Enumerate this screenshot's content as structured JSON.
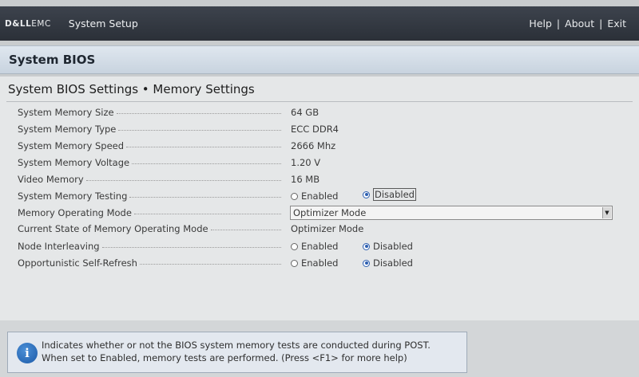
{
  "topbar": {
    "logo_bold": "D&LL",
    "logo_rest": "EMC",
    "title": "System Setup",
    "links": [
      "Help",
      "About",
      "Exit"
    ],
    "separator": "|"
  },
  "page_header": "System BIOS",
  "subtitle": "System BIOS Settings • Memory Settings",
  "settings": [
    {
      "label": "System Memory Size",
      "value": "64 GB"
    },
    {
      "label": "System Memory Type",
      "value": "ECC DDR4"
    },
    {
      "label": "System Memory Speed",
      "value": "2666 Mhz"
    },
    {
      "label": "System Memory Voltage",
      "value": "1.20 V"
    },
    {
      "label": "Video Memory",
      "value": "16 MB"
    },
    {
      "label": "System Memory Testing",
      "options": [
        "Enabled",
        "Disabled"
      ],
      "selected": "Disabled"
    },
    {
      "label": "Memory Operating Mode",
      "value": "Optimizer Mode"
    },
    {
      "label": "Current State of Memory Operating Mode",
      "value": "Optimizer Mode"
    },
    {
      "label": "Node Interleaving",
      "options": [
        "Enabled",
        "Disabled"
      ],
      "selected": "Disabled"
    },
    {
      "label": "Opportunistic Self-Refresh",
      "options": [
        "Enabled",
        "Disabled"
      ],
      "selected": "Disabled"
    }
  ],
  "info": {
    "icon": "info-icon",
    "glyph": "i",
    "line1": "Indicates whether or not the BIOS system memory tests are conducted during POST.",
    "line2": "When set to Enabled, memory tests are performed. (Press <F1> for more help)"
  },
  "colors": {
    "radio_selected": "#2d5fb0",
    "topbar": "#2b3038"
  }
}
